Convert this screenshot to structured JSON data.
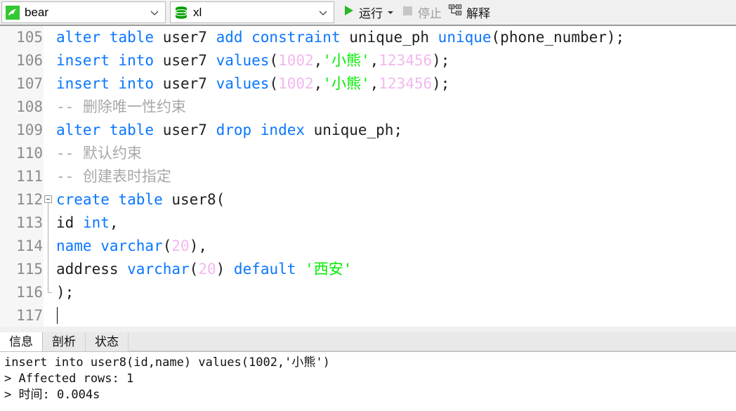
{
  "toolbar": {
    "connection": {
      "icon": "mysql-dolphin-icon",
      "label": "bear",
      "dropdown_icon": "chevron-down-icon"
    },
    "database": {
      "icon": "database-cylinder-icon",
      "label": "xl",
      "dropdown_icon": "chevron-down-icon"
    },
    "run": {
      "icon": "play-triangle-icon",
      "label": "运行",
      "dropdown_icon": "caret-down-icon"
    },
    "stop": {
      "icon": "stop-square-icon",
      "label": "停止",
      "enabled": false
    },
    "explain": {
      "icon": "explain-plan-icon",
      "label": "解释"
    }
  },
  "editor": {
    "first_line": 105,
    "colors": {
      "keyword": "#0a76ff",
      "number": "#f2b8ef",
      "string": "#00ee00",
      "comment": "#a8a8a8",
      "plain": "#202020",
      "gutter_bg": "#f6f6f6",
      "gutter_text": "#8b8b8b"
    },
    "lines": [
      {
        "no": "105",
        "fold": "none",
        "tokens": [
          {
            "t": "alter table ",
            "c": "kw"
          },
          {
            "t": "user7 ",
            "c": "pl"
          },
          {
            "t": "add constraint ",
            "c": "kw"
          },
          {
            "t": "unique_ph ",
            "c": "pl"
          },
          {
            "t": "unique",
            "c": "kw"
          },
          {
            "t": "(phone_number);",
            "c": "pl"
          }
        ]
      },
      {
        "no": "106",
        "fold": "none",
        "tokens": [
          {
            "t": "insert into ",
            "c": "kw"
          },
          {
            "t": "user7 ",
            "c": "pl"
          },
          {
            "t": "values",
            "c": "kw"
          },
          {
            "t": "(",
            "c": "pl"
          },
          {
            "t": "1002",
            "c": "num"
          },
          {
            "t": ",",
            "c": "pl"
          },
          {
            "t": "'小熊'",
            "c": "str"
          },
          {
            "t": ",",
            "c": "pl"
          },
          {
            "t": "123456",
            "c": "num"
          },
          {
            "t": ");",
            "c": "pl"
          }
        ]
      },
      {
        "no": "107",
        "fold": "none",
        "tokens": [
          {
            "t": "insert into ",
            "c": "kw"
          },
          {
            "t": "user7 ",
            "c": "pl"
          },
          {
            "t": "values",
            "c": "kw"
          },
          {
            "t": "(",
            "c": "pl"
          },
          {
            "t": "1002",
            "c": "num"
          },
          {
            "t": ",",
            "c": "pl"
          },
          {
            "t": "'小熊'",
            "c": "str"
          },
          {
            "t": ",",
            "c": "pl"
          },
          {
            "t": "123456",
            "c": "num"
          },
          {
            "t": ");",
            "c": "pl"
          }
        ]
      },
      {
        "no": "108",
        "fold": "none",
        "tokens": [
          {
            "t": "-- 删除唯一性约束",
            "c": "cmt"
          }
        ]
      },
      {
        "no": "109",
        "fold": "none",
        "tokens": [
          {
            "t": "alter table ",
            "c": "kw"
          },
          {
            "t": "user7 ",
            "c": "pl"
          },
          {
            "t": "drop index ",
            "c": "kw"
          },
          {
            "t": "unique_ph;",
            "c": "pl"
          }
        ]
      },
      {
        "no": "110",
        "fold": "none",
        "tokens": [
          {
            "t": "-- 默认约束",
            "c": "cmt"
          }
        ]
      },
      {
        "no": "111",
        "fold": "none",
        "tokens": [
          {
            "t": "-- 创建表时指定",
            "c": "cmt"
          }
        ]
      },
      {
        "no": "112",
        "fold": "start",
        "tokens": [
          {
            "t": "create table ",
            "c": "kw"
          },
          {
            "t": "user8(",
            "c": "pl"
          }
        ]
      },
      {
        "no": "113",
        "fold": "mid",
        "tokens": [
          {
            "t": "id ",
            "c": "pl"
          },
          {
            "t": "int",
            "c": "kw"
          },
          {
            "t": ",",
            "c": "pl"
          }
        ]
      },
      {
        "no": "114",
        "fold": "mid",
        "tokens": [
          {
            "t": "name ",
            "c": "kw"
          },
          {
            "t": "varchar",
            "c": "kw"
          },
          {
            "t": "(",
            "c": "pl"
          },
          {
            "t": "20",
            "c": "num"
          },
          {
            "t": "),",
            "c": "pl"
          }
        ]
      },
      {
        "no": "115",
        "fold": "mid",
        "tokens": [
          {
            "t": "address ",
            "c": "pl"
          },
          {
            "t": "varchar",
            "c": "kw"
          },
          {
            "t": "(",
            "c": "pl"
          },
          {
            "t": "20",
            "c": "num"
          },
          {
            "t": ") ",
            "c": "pl"
          },
          {
            "t": "default ",
            "c": "kw"
          },
          {
            "t": "'西安'",
            "c": "str"
          }
        ]
      },
      {
        "no": "116",
        "fold": "end",
        "tokens": [
          {
            "t": ");",
            "c": "pl"
          }
        ]
      },
      {
        "no": "117",
        "fold": "none",
        "caret": true,
        "tokens": []
      }
    ]
  },
  "bottom_panel": {
    "tabs": [
      {
        "label": "信息",
        "active": true
      },
      {
        "label": "剖析",
        "active": false
      },
      {
        "label": "状态",
        "active": false
      }
    ],
    "output_lines": [
      "insert into user8(id,name) values(1002,'小熊')",
      "> Affected rows: 1",
      "> 时间: 0.004s"
    ]
  }
}
